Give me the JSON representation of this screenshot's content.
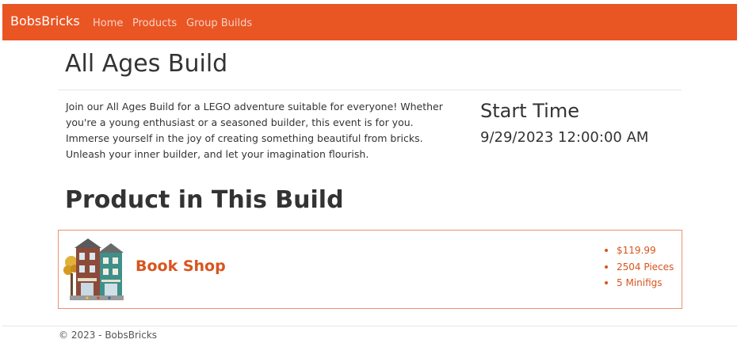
{
  "nav": {
    "brand": "BobsBricks",
    "links": [
      "Home",
      "Products",
      "Group Builds"
    ]
  },
  "page": {
    "title": "All Ages Build",
    "description": "Join our All Ages Build for a LEGO adventure suitable for everyone! Whether you're a young enthusiast or a seasoned builder, this event is for you. Immerse yourself in the joy of creating something beautiful from bricks. Unleash your inner builder, and let your imagination flourish.",
    "start_label": "Start Time",
    "start_value": "9/29/2023 12:00:00 AM",
    "product_heading": "Product in This Build"
  },
  "product": {
    "name": "Book Shop",
    "image_icon": "book-shop-set-image",
    "specs": [
      "$119.99",
      "2504 Pieces",
      "5 Minifigs"
    ]
  },
  "footer": {
    "text": "© 2023 - BobsBricks"
  },
  "colors": {
    "brand": "#ea5524",
    "accent_text": "#d9541f",
    "card_border": "#ea9270"
  }
}
